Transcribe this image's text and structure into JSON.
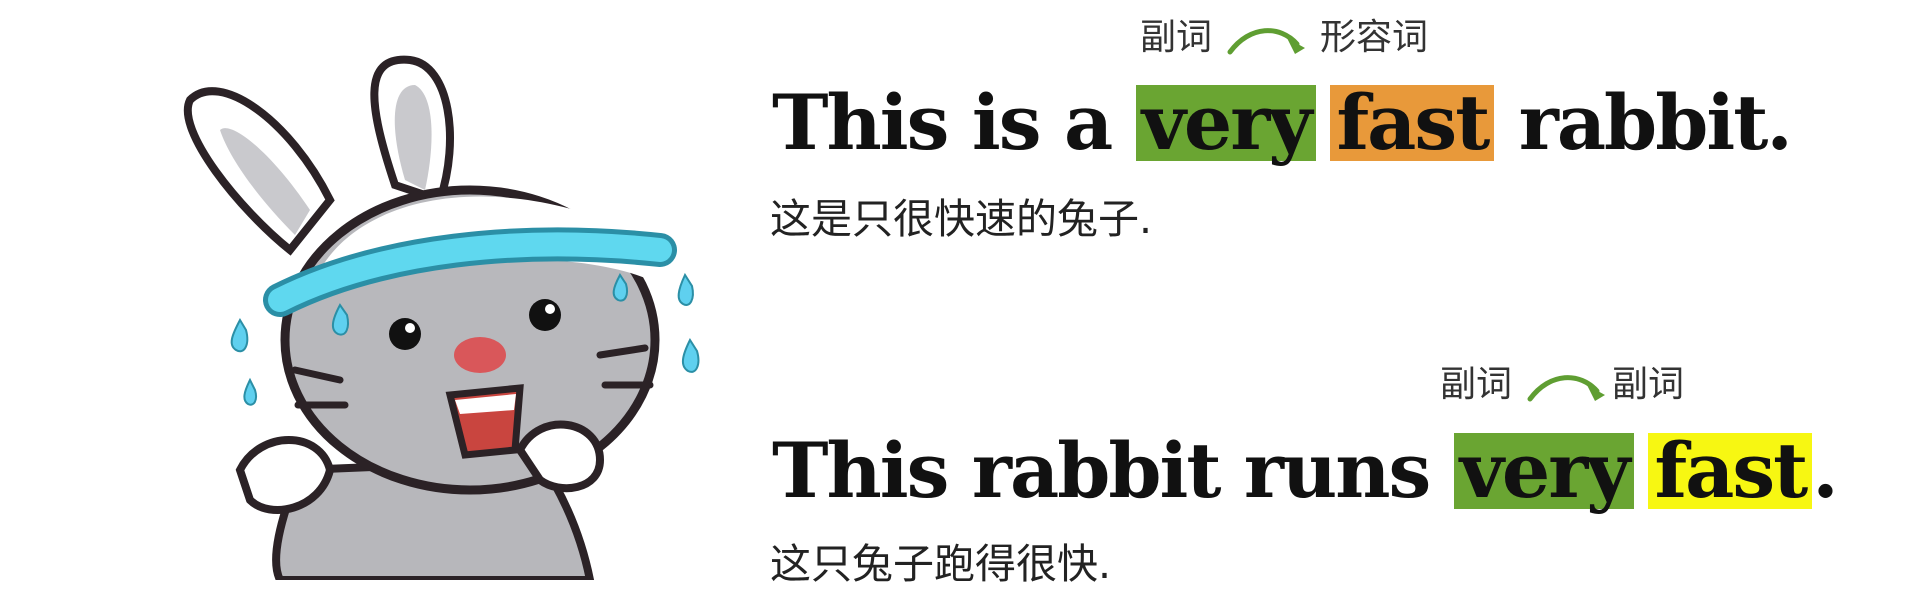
{
  "example1": {
    "before": "This is a ",
    "word1": "very",
    "word2": "fast",
    "after": " rabbit.",
    "translation": "这是只很快速的兔子.",
    "label1": "副词",
    "label2": "形容词"
  },
  "example2": {
    "before": "This rabbit runs ",
    "word1": "very",
    "word2": "fast",
    "after": ".",
    "translation": "这只兔子跑得很快.",
    "label1": "副词",
    "label2": "副词"
  },
  "colors": {
    "adverb": "#6aa532",
    "adjective": "#e8993a",
    "adverb_second": "#f7f712",
    "arrow": "#5f9e32",
    "headband": "#5fd8ef"
  },
  "icons": [
    "rabbit-illustration",
    "curved-arrow-icon",
    "sweat-drop-icon"
  ]
}
